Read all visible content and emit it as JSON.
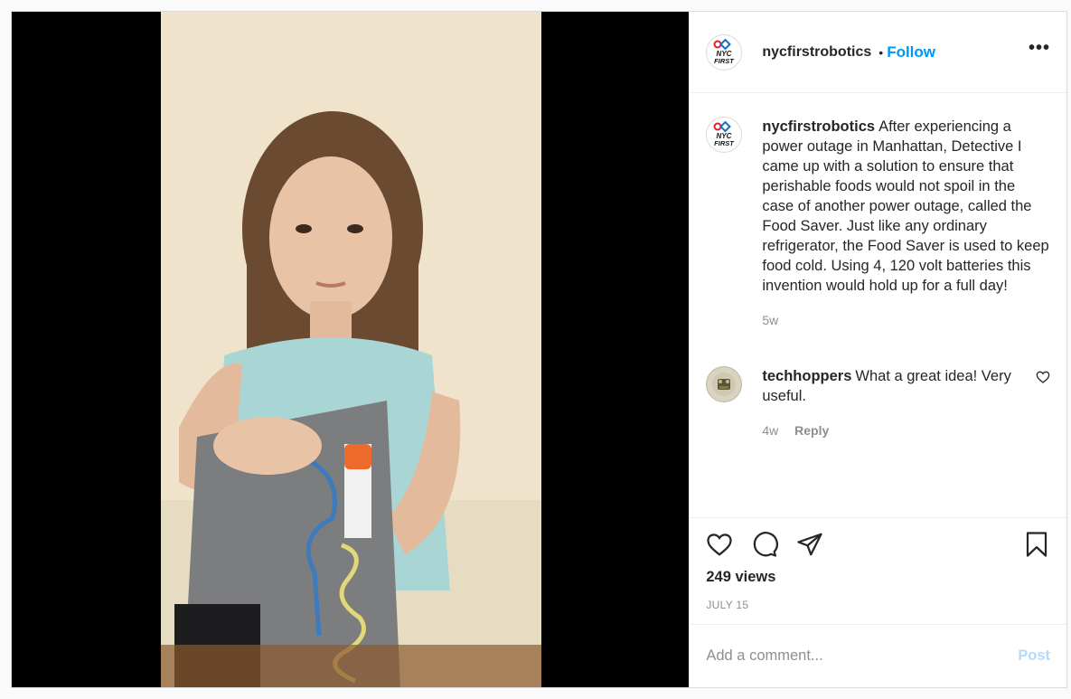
{
  "header": {
    "username": "nycfirstrobotics",
    "separator": "•",
    "follow_label": "Follow",
    "more_label": "•••"
  },
  "caption": {
    "username": "nycfirstrobotics",
    "text": "After experiencing a power outage in Manhattan, Detective I came up with a solution to ensure that perishable foods would not spoil in the case of another power outage, called the Food Saver. Just like any ordinary refrigerator, the Food Saver is used to keep food cold. Using 4, 120 volt batteries this invention would hold up for a full day!",
    "age": "5w"
  },
  "comments": [
    {
      "username": "techhoppers",
      "text": "What a great idea! Very useful.",
      "age": "4w",
      "reply_label": "Reply"
    }
  ],
  "avatar_logo": {
    "line1": "NYC",
    "line2": "FIRST"
  },
  "stats": {
    "views": "249 views",
    "date": "JULY 15"
  },
  "add_comment": {
    "placeholder": "Add a comment...",
    "post_label": "Post"
  },
  "colors": {
    "accent": "#0095f6",
    "post_disabled": "#b3dbff",
    "muted": "#8e8e8e",
    "text": "#262626"
  },
  "icons": [
    "heart-icon",
    "comment-icon",
    "share-icon",
    "bookmark-icon",
    "more-icon",
    "small-heart-icon"
  ]
}
